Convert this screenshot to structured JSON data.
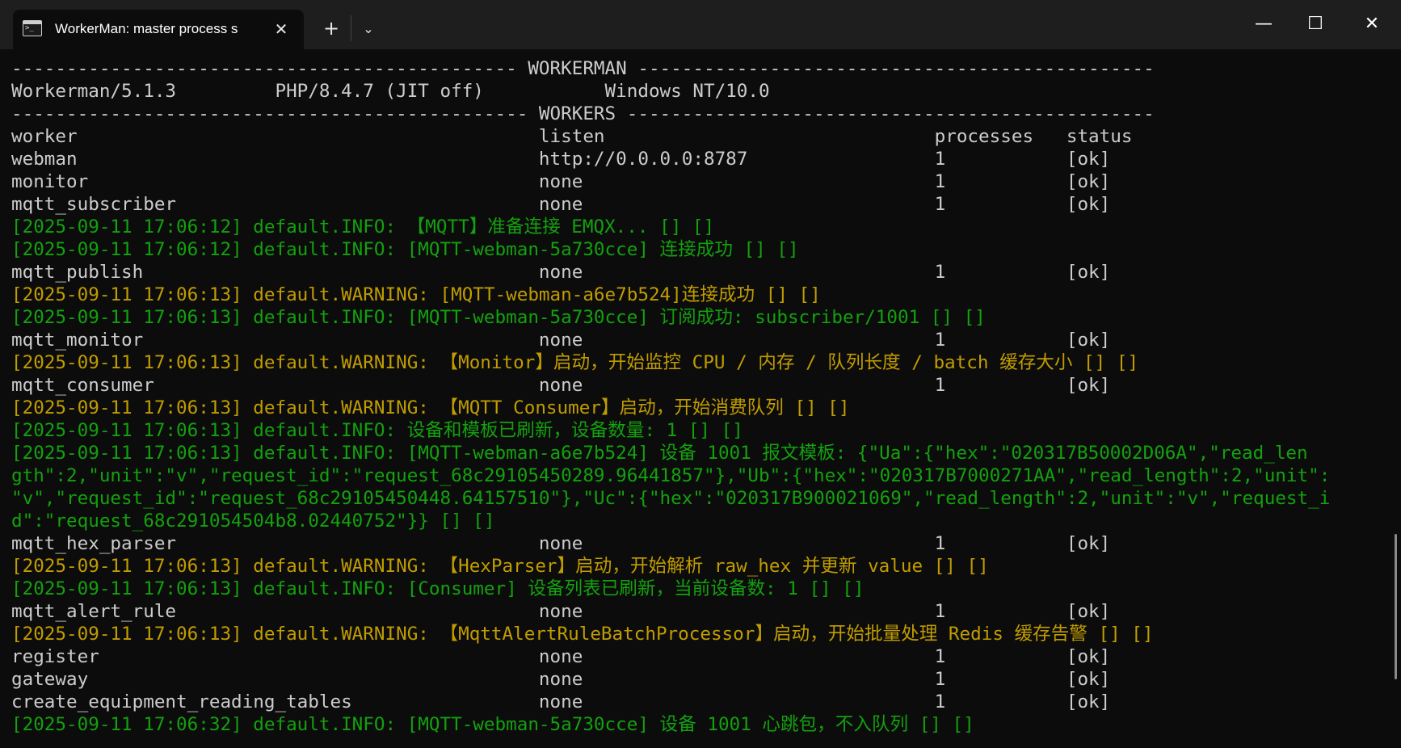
{
  "window": {
    "tab_title": "WorkerMan: master process  s",
    "close_glyph": "✕",
    "new_tab_glyph": "+",
    "dropdown_glyph": "⌄",
    "minimize_glyph": "—",
    "maximize_glyph": "☐",
    "window_close_glyph": "✕",
    "icons": [
      "terminal-icon",
      "close-icon",
      "plus-icon",
      "chevron-down-icon",
      "minimize-icon",
      "maximize-icon",
      "close-icon"
    ]
  },
  "colors": {
    "background": "#0c0c0c",
    "titlebar": "#1e1e1e",
    "text": "#cccccc",
    "info": "#13a10e",
    "warning": "#c19c00"
  },
  "terminal": {
    "lines": [
      {
        "style": "std",
        "text": "---------------------------------------------- WORKERMAN -----------------------------------------------"
      },
      {
        "style": "std",
        "text": "Workerman/5.1.3         PHP/8.4.7 (JIT off)           Windows NT/10.0"
      },
      {
        "style": "std",
        "text": "----------------------------------------------- WORKERS ------------------------------------------------"
      },
      {
        "style": "std",
        "text": "worker                                          listen                              processes   status"
      },
      {
        "style": "std",
        "text": "webman                                          http://0.0.0.0:8787                 1           [ok]"
      },
      {
        "style": "std",
        "text": "monitor                                         none                                1           [ok]"
      },
      {
        "style": "std",
        "text": "mqtt_subscriber                                 none                                1           [ok]"
      },
      {
        "style": "info",
        "text": "[2025-09-11 17:06:12] default.INFO: 【MQTT】准备连接 EMQX... [] []"
      },
      {
        "style": "info",
        "text": "[2025-09-11 17:06:12] default.INFO: [MQTT-webman-5a730cce] 连接成功 [] []"
      },
      {
        "style": "std",
        "text": "mqtt_publish                                    none                                1           [ok]"
      },
      {
        "style": "warn",
        "text": "[2025-09-11 17:06:13] default.WARNING: [MQTT-webman-a6e7b524]连接成功 [] []"
      },
      {
        "style": "info",
        "text": "[2025-09-11 17:06:13] default.INFO: [MQTT-webman-5a730cce] 订阅成功: subscriber/1001 [] []"
      },
      {
        "style": "std",
        "text": "mqtt_monitor                                    none                                1           [ok]"
      },
      {
        "style": "warn",
        "text": "[2025-09-11 17:06:13] default.WARNING: 【Monitor】启动，开始监控 CPU / 内存 / 队列长度 / batch 缓存大小 [] []"
      },
      {
        "style": "std",
        "text": "mqtt_consumer                                   none                                1           [ok]"
      },
      {
        "style": "warn",
        "text": "[2025-09-11 17:06:13] default.WARNING: 【MQTT Consumer】启动，开始消费队列 [] []"
      },
      {
        "style": "info",
        "text": "[2025-09-11 17:06:13] default.INFO: 设备和模板已刷新，设备数量: 1 [] []"
      },
      {
        "style": "info",
        "text": "[2025-09-11 17:06:13] default.INFO: [MQTT-webman-a6e7b524] 设备 1001 报文模板: {\"Ua\":{\"hex\":\"020317B50002D06A\",\"read_len"
      },
      {
        "style": "info",
        "text": "gth\":2,\"unit\":\"v\",\"request_id\":\"request_68c29105450289.96441857\"},\"Ub\":{\"hex\":\"020317B7000271AA\",\"read_length\":2,\"unit\":"
      },
      {
        "style": "info",
        "text": "\"v\",\"request_id\":\"request_68c29105450448.64157510\"},\"Uc\":{\"hex\":\"020317B900021069\",\"read_length\":2,\"unit\":\"v\",\"request_i"
      },
      {
        "style": "info",
        "text": "d\":\"request_68c291054504b8.02440752\"}} [] []"
      },
      {
        "style": "std",
        "text": "mqtt_hex_parser                                 none                                1           [ok]"
      },
      {
        "style": "warn",
        "text": "[2025-09-11 17:06:13] default.WARNING: 【HexParser】启动，开始解析 raw_hex 并更新 value [] []"
      },
      {
        "style": "info",
        "text": "[2025-09-11 17:06:13] default.INFO: [Consumer] 设备列表已刷新，当前设备数: 1 [] []"
      },
      {
        "style": "std",
        "text": "mqtt_alert_rule                                 none                                1           [ok]"
      },
      {
        "style": "warn",
        "text": "[2025-09-11 17:06:13] default.WARNING: 【MqttAlertRuleBatchProcessor】启动，开始批量处理 Redis 缓存告警 [] []"
      },
      {
        "style": "std",
        "text": "register                                        none                                1           [ok]"
      },
      {
        "style": "std",
        "text": "gateway                                         none                                1           [ok]"
      },
      {
        "style": "std",
        "text": "create_equipment_reading_tables                 none                                1           [ok]"
      },
      {
        "style": "info",
        "text": "[2025-09-11 17:06:32] default.INFO: [MQTT-webman-5a730cce] 设备 1001 心跳包，不入队列 [] []"
      }
    ]
  }
}
